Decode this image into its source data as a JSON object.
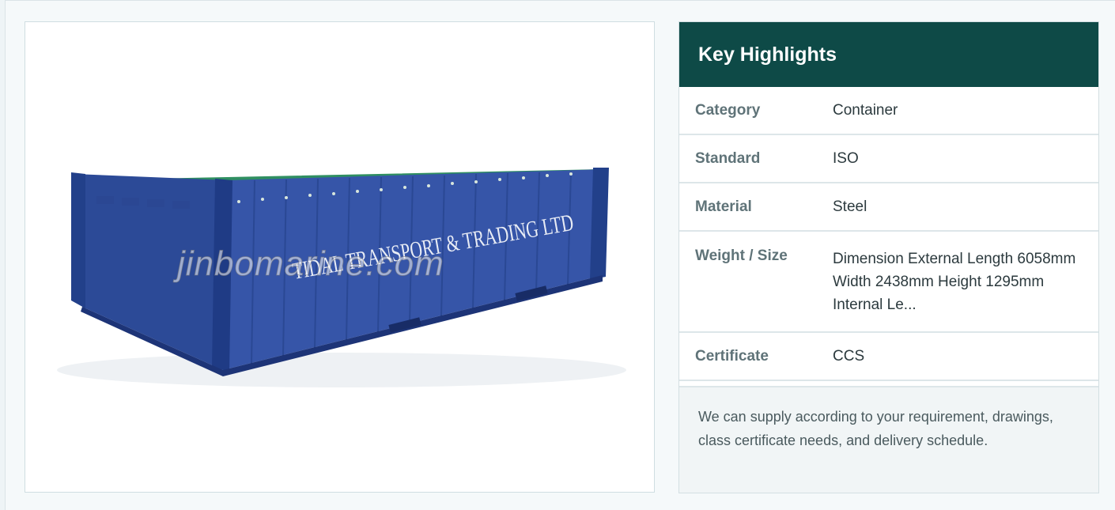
{
  "product_image": {
    "container_lettering": "TIDAL TRANSPORT & TRADING LTD",
    "watermark": "jinbomarine.com",
    "colors": {
      "container": "#2f4fa0",
      "tarp": "#2e8a5e"
    }
  },
  "highlights": {
    "title": "Key Highlights",
    "header_color": "#0e4a47",
    "rows": [
      {
        "label": "Category",
        "value": "Container"
      },
      {
        "label": "Standard",
        "value": "ISO"
      },
      {
        "label": "Material",
        "value": "Steel"
      },
      {
        "label": "Weight / Size",
        "value": "Dimension External  Length 6058mm Width 2438mm Height 1295mm Internal Le..."
      },
      {
        "label": "Certificate",
        "value": "CCS"
      }
    ],
    "note": "We can supply according to your requirement, drawings, class certificate needs, and delivery schedule."
  }
}
